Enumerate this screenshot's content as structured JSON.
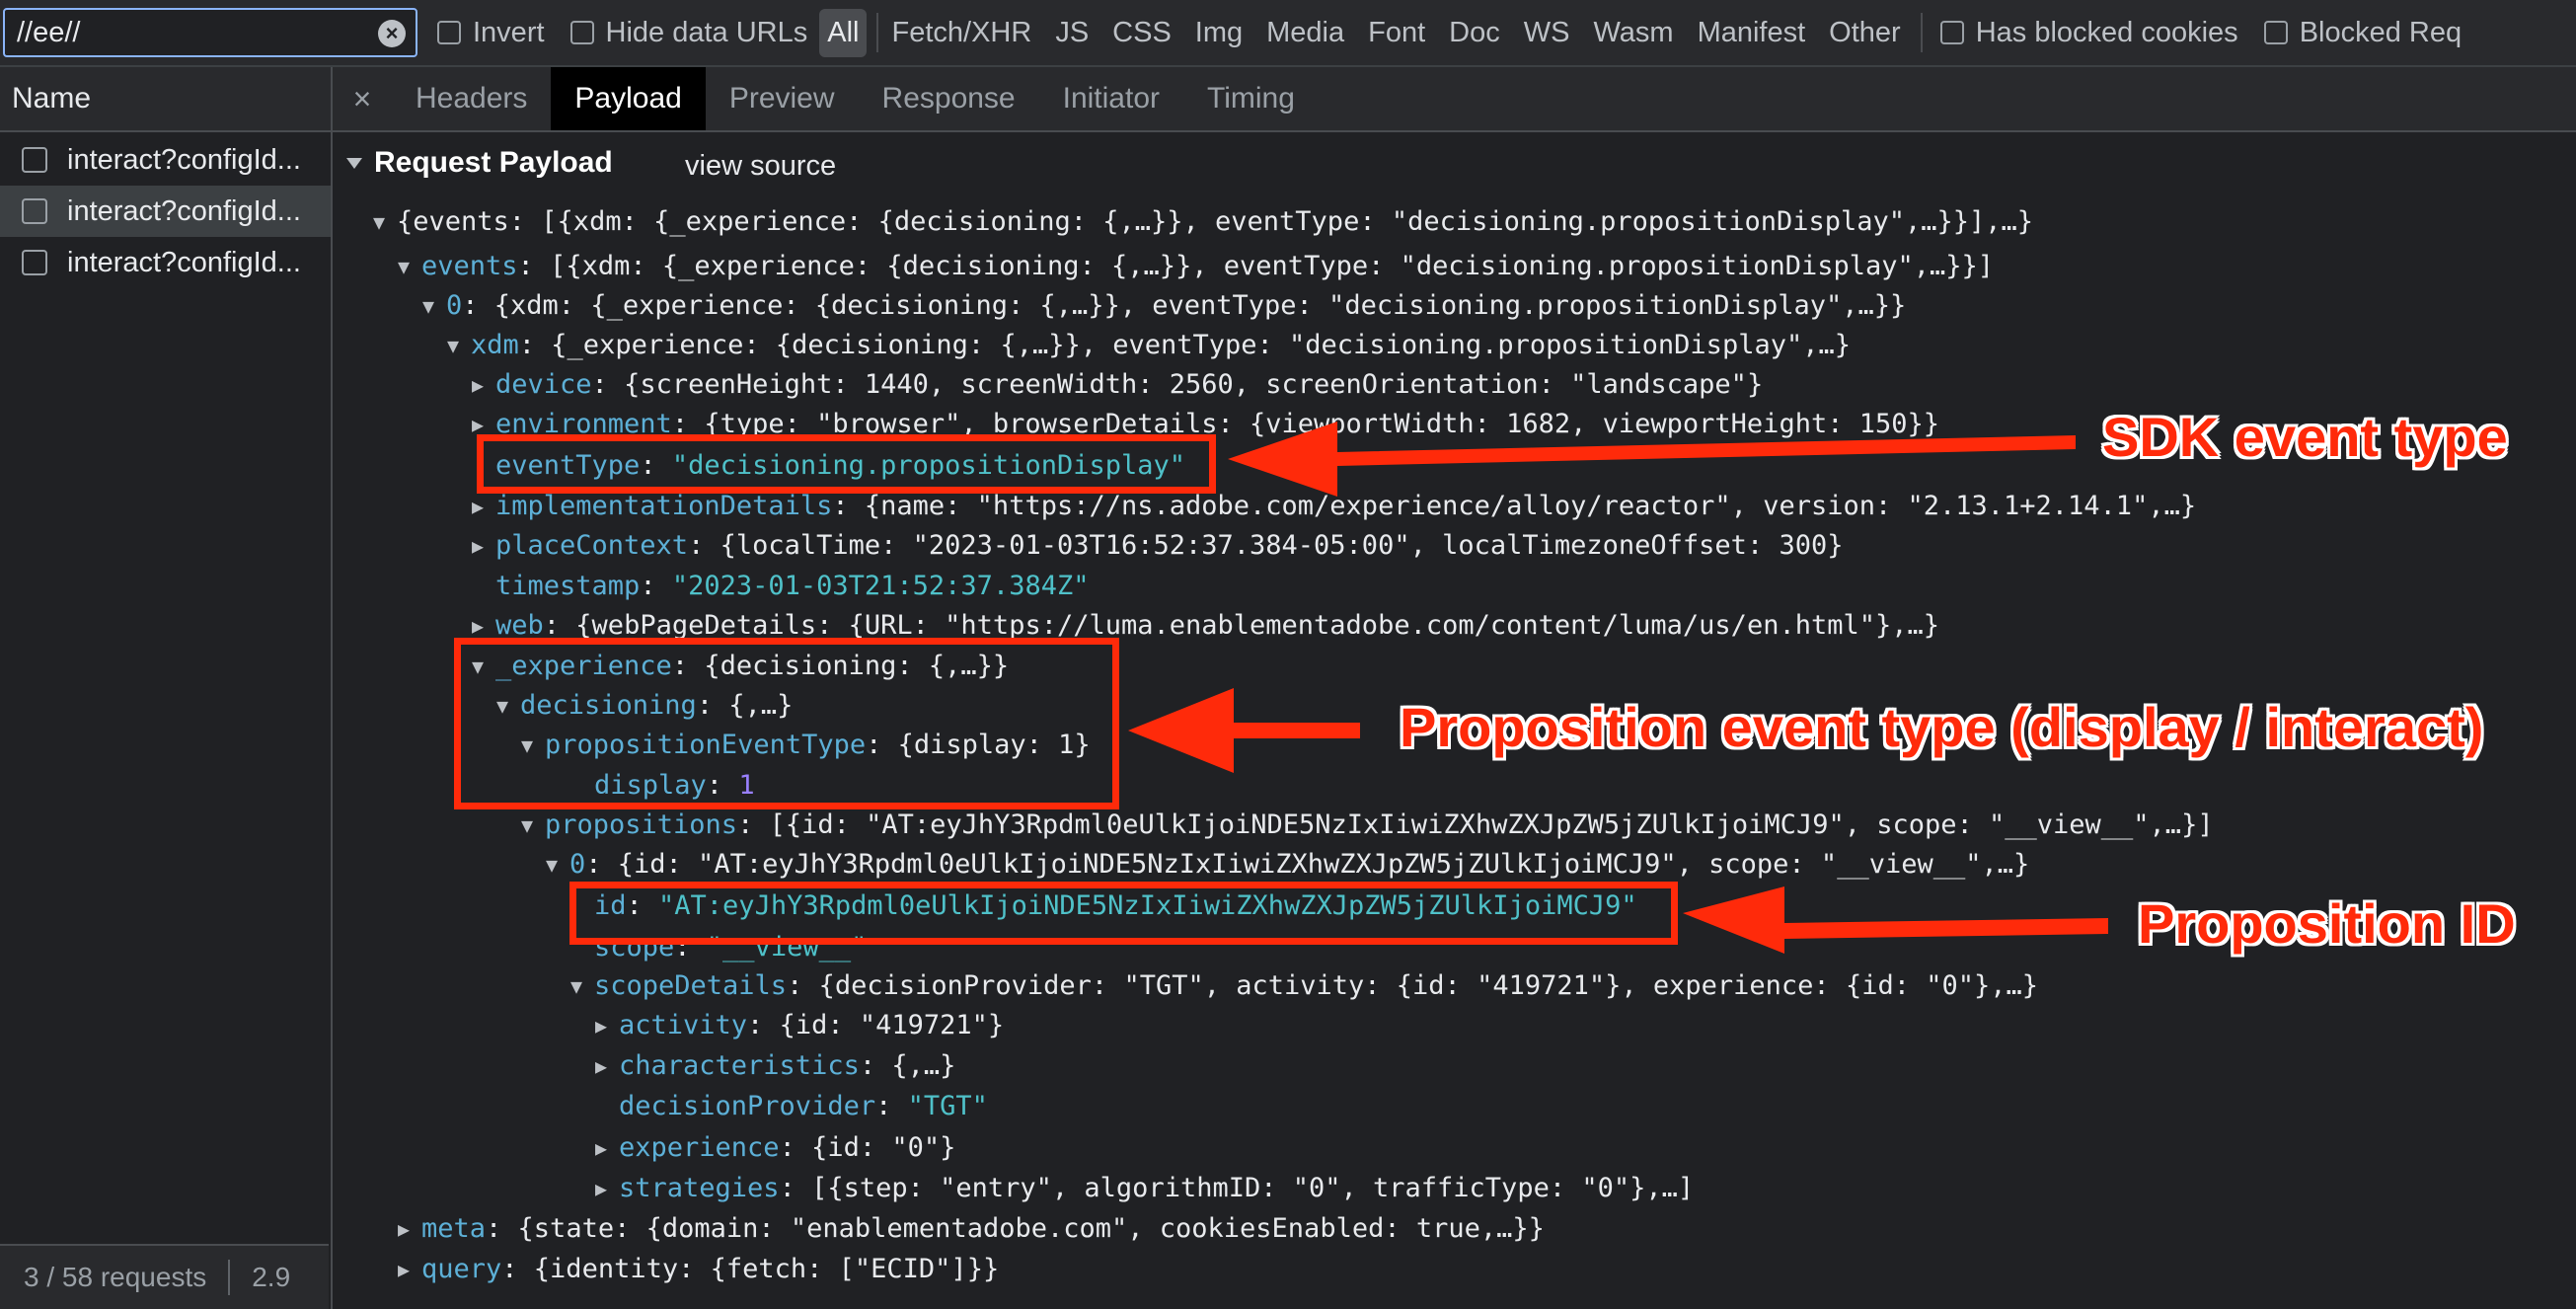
{
  "filter": {
    "value": "//ee//",
    "clear_icon": "clear-icon"
  },
  "filter_options": {
    "invert": "Invert",
    "hide_data_urls": "Hide data URLs",
    "has_blocked_cookies": "Has blocked cookies",
    "blocked_requests": "Blocked Req"
  },
  "type_filters": [
    "All",
    "Fetch/XHR",
    "JS",
    "CSS",
    "Img",
    "Media",
    "Font",
    "Doc",
    "WS",
    "Wasm",
    "Manifest",
    "Other"
  ],
  "request_list": {
    "header": "Name",
    "rows": [
      "interact?configId...",
      "interact?configId...",
      "interact?configId..."
    ],
    "status_count": "3 / 58 requests",
    "status_size": "2.9"
  },
  "tabs": {
    "close": "×",
    "items": [
      "Headers",
      "Payload",
      "Preview",
      "Response",
      "Initiator",
      "Timing"
    ],
    "active": "Payload"
  },
  "payload": {
    "section_title": "Request Payload",
    "view_source": "view source"
  },
  "tree": [
    {
      "tri": "down",
      "key": "",
      "sep": "",
      "val": "{events: [{xdm: {_experience: {decisioning: {,…}}, eventType: \"decisioning.propositionDisplay\",…}}],…}",
      "vt": "plain"
    },
    {
      "tri": "down",
      "key": "events",
      "sep": ": ",
      "val": "[{xdm: {_experience: {decisioning: {,…}}, eventType: \"decisioning.propositionDisplay\",…}}]",
      "vt": "plain"
    },
    {
      "tri": "down",
      "key": "0",
      "sep": ": ",
      "val": "{xdm: {_experience: {decisioning: {,…}}, eventType: \"decisioning.propositionDisplay\",…}}",
      "vt": "plain"
    },
    {
      "tri": "down",
      "key": "xdm",
      "sep": ": ",
      "val": "{_experience: {decisioning: {,…}}, eventType: \"decisioning.propositionDisplay\",…}",
      "vt": "plain"
    },
    {
      "tri": "right",
      "key": "device",
      "sep": ": ",
      "val": "{screenHeight: 1440, screenWidth: 2560, screenOrientation: \"landscape\"}",
      "vt": "plain"
    },
    {
      "tri": "right",
      "key": "environment",
      "sep": ": ",
      "val": "{type: \"browser\", browserDetails: {viewportWidth: 1682, viewportHeight: 150}}",
      "vt": "plain"
    },
    {
      "tri": "none",
      "key": "eventType",
      "sep": ": ",
      "val": "\"decisioning.propositionDisplay\"",
      "vt": "str"
    },
    {
      "tri": "right",
      "key": "implementationDetails",
      "sep": ": ",
      "val": "{name: \"https://ns.adobe.com/experience/alloy/reactor\", version: \"2.13.1+2.14.1\",…}",
      "vt": "plain"
    },
    {
      "tri": "right",
      "key": "placeContext",
      "sep": ": ",
      "val": "{localTime: \"2023-01-03T16:52:37.384-05:00\", localTimezoneOffset: 300}",
      "vt": "plain"
    },
    {
      "tri": "none",
      "key": "timestamp",
      "sep": ": ",
      "val": "\"2023-01-03T21:52:37.384Z\"",
      "vt": "str"
    },
    {
      "tri": "right",
      "key": "web",
      "sep": ": ",
      "val": "{webPageDetails: {URL: \"https://luma.enablementadobe.com/content/luma/us/en.html\"},…}",
      "vt": "plain"
    },
    {
      "tri": "down",
      "key": "_experience",
      "sep": ": ",
      "val": "{decisioning: {,…}}",
      "vt": "plain"
    },
    {
      "tri": "down",
      "key": "decisioning",
      "sep": ": ",
      "val": "{,…}",
      "vt": "plain"
    },
    {
      "tri": "down",
      "key": "propositionEventType",
      "sep": ": ",
      "val": "{display: 1}",
      "vt": "plain"
    },
    {
      "tri": "none",
      "key": "display",
      "sep": ": ",
      "val": "1",
      "vt": "num"
    },
    {
      "tri": "down",
      "key": "propositions",
      "sep": ": ",
      "val": "[{id: \"AT:eyJhY3Rpdml0eUlkIjoiNDE5NzIxIiwiZXhwZXJpZW5jZUlkIjoiMCJ9\", scope: \"__view__\",…}]",
      "vt": "plain"
    },
    {
      "tri": "down",
      "key": "0",
      "sep": ": ",
      "val": "{id: \"AT:eyJhY3Rpdml0eUlkIjoiNDE5NzIxIiwiZXhwZXJpZW5jZUlkIjoiMCJ9\", scope: \"__view__\",…}",
      "vt": "plain"
    },
    {
      "tri": "none",
      "key": "id",
      "sep": ": ",
      "val": "\"AT:eyJhY3Rpdml0eUlkIjoiNDE5NzIxIiwiZXhwZXJpZW5jZUlkIjoiMCJ9\"",
      "vt": "str"
    },
    {
      "tri": "none",
      "key": "scope",
      "sep": ": ",
      "val": "\"__view__\"",
      "vt": "str"
    },
    {
      "tri": "down",
      "key": "scopeDetails",
      "sep": ": ",
      "val": "{decisionProvider: \"TGT\", activity: {id: \"419721\"}, experience: {id: \"0\"},…}",
      "vt": "plain"
    },
    {
      "tri": "right",
      "key": "activity",
      "sep": ": ",
      "val": "{id: \"419721\"}",
      "vt": "plain"
    },
    {
      "tri": "right",
      "key": "characteristics",
      "sep": ": ",
      "val": "{,…}",
      "vt": "plain"
    },
    {
      "tri": "none",
      "key": "decisionProvider",
      "sep": ": ",
      "val": "\"TGT\"",
      "vt": "str"
    },
    {
      "tri": "right",
      "key": "experience",
      "sep": ": ",
      "val": "{id: \"0\"}",
      "vt": "plain"
    },
    {
      "tri": "right",
      "key": "strategies",
      "sep": ": ",
      "val": "[{step: \"entry\", algorithmID: \"0\", trafficType: \"0\"},…]",
      "vt": "plain"
    },
    {
      "tri": "right",
      "key": "meta",
      "sep": ": ",
      "val": "{state: {domain: \"enablementadobe.com\", cookiesEnabled: true,…}}",
      "vt": "plain"
    },
    {
      "tri": "right",
      "key": "query",
      "sep": ": ",
      "val": "{identity: {fetch: [\"ECID\"]}}",
      "vt": "plain"
    }
  ],
  "annotations": {
    "sdk_event_type": "SDK event type",
    "proposition_event_type": "Proposition event type (display / interact)",
    "proposition_id": "Proposition ID",
    "color": "#ff2a0a"
  },
  "colors": {
    "key": "#5db0d7",
    "string": "#4fc1c9",
    "number": "#9980ff",
    "background": "#202124"
  }
}
